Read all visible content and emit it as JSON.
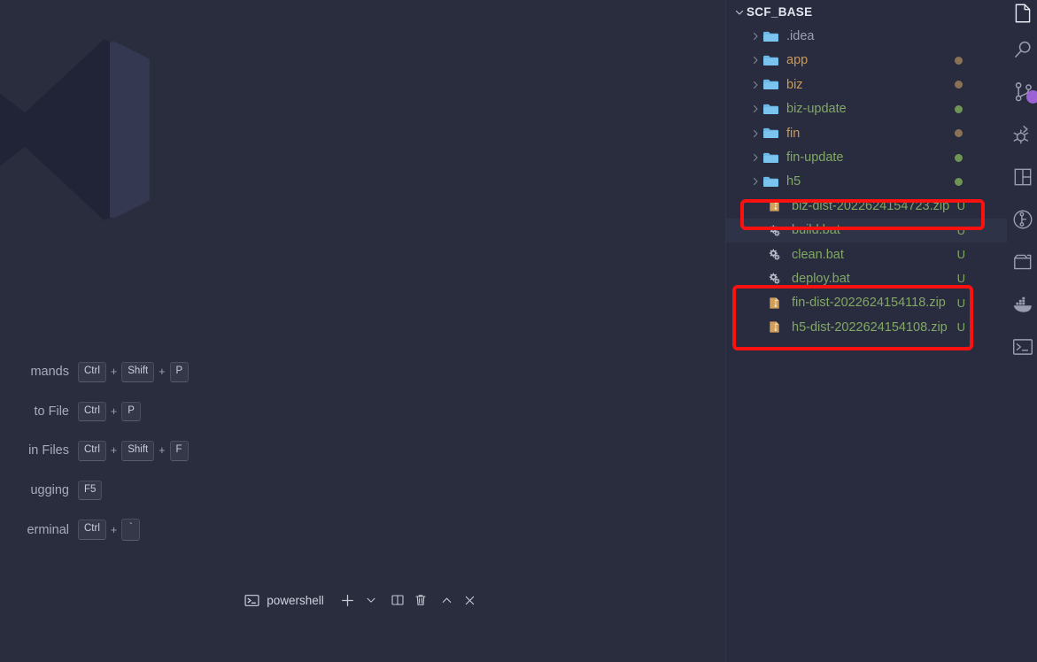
{
  "window": {
    "app": "Visual Studio Code",
    "editor_background": "#2a2d3e",
    "sidebar_background": "#292c3e",
    "annotation_color": "#fc1111",
    "untracked_color": "#81a865",
    "modified_color": "#8a7256"
  },
  "watermark": {
    "icon": "vscode-logo-watermark"
  },
  "shortcuts": {
    "rows": [
      {
        "label": "mands",
        "full_label": "Show All Commands",
        "keys": [
          "Ctrl",
          "Shift",
          "P"
        ]
      },
      {
        "label": "to File",
        "full_label": "Go to File",
        "keys": [
          "Ctrl",
          "P"
        ]
      },
      {
        "label": "in Files",
        "full_label": "Find in Files",
        "keys": [
          "Ctrl",
          "Shift",
          "F"
        ]
      },
      {
        "label": "ugging",
        "full_label": "Start Debugging",
        "keys": [
          "F5"
        ]
      },
      {
        "label": "erminal",
        "full_label": "Toggle Terminal",
        "keys": [
          "Ctrl",
          "`"
        ]
      }
    ],
    "separator": "+"
  },
  "terminal": {
    "icon": "terminal-powershell-icon",
    "name": "powershell",
    "actions": [
      {
        "name": "new-terminal-button",
        "icon": "plus-icon"
      },
      {
        "name": "terminal-profile-dropdown",
        "icon": "chevron-down-icon"
      },
      {
        "name": "split-terminal-button",
        "icon": "split-icon"
      },
      {
        "name": "kill-terminal-button",
        "icon": "trash-icon"
      },
      {
        "name": "maximize-panel-button",
        "icon": "chevron-up-icon"
      },
      {
        "name": "close-panel-button",
        "icon": "close-icon"
      }
    ]
  },
  "explorer": {
    "root": {
      "label": "SCF_BASE",
      "expanded": true
    },
    "items": [
      {
        "label": ".idea",
        "type": "folder",
        "expanded": false,
        "color": "#9ba0b5",
        "decoration": "",
        "dot": ""
      },
      {
        "label": "app",
        "type": "folder",
        "expanded": false,
        "color": "#c99a59",
        "decoration": "",
        "dot": "#8a7256"
      },
      {
        "label": "biz",
        "type": "folder",
        "expanded": false,
        "color": "#c99a59",
        "decoration": "",
        "dot": "#8a7256"
      },
      {
        "label": "biz-update",
        "type": "folder",
        "expanded": false,
        "color": "#81a865",
        "decoration": "",
        "dot": "#6f9456"
      },
      {
        "label": "fin",
        "type": "folder",
        "expanded": false,
        "color": "#c99a59",
        "decoration": "",
        "dot": "#8a7256"
      },
      {
        "label": "fin-update",
        "type": "folder",
        "expanded": false,
        "color": "#81a865",
        "decoration": "",
        "dot": "#6f9456"
      },
      {
        "label": "h5",
        "type": "folder",
        "expanded": false,
        "color": "#81a865",
        "decoration": "",
        "dot": "#6f9456"
      },
      {
        "label": "biz-dist-2022624154723.zip",
        "type": "zip",
        "color": "#81a865",
        "decoration": "U",
        "dot": ""
      },
      {
        "label": "build.bat",
        "type": "bat",
        "color": "#81a865",
        "decoration": "U",
        "dot": "",
        "hover": true
      },
      {
        "label": "clean.bat",
        "type": "bat",
        "color": "#81a865",
        "decoration": "U",
        "dot": ""
      },
      {
        "label": "deploy.bat",
        "type": "bat",
        "color": "#81a865",
        "decoration": "U",
        "dot": ""
      },
      {
        "label": "fin-dist-2022624154118.zip",
        "type": "zip",
        "color": "#81a865",
        "decoration": "U",
        "dot": ""
      },
      {
        "label": "h5-dist-2022624154108.zip",
        "type": "zip",
        "color": "#81a865",
        "decoration": "U",
        "dot": ""
      }
    ]
  },
  "activitybar": {
    "items": [
      {
        "name": "explorer-icon",
        "active": true
      },
      {
        "name": "search-icon",
        "active": false
      },
      {
        "name": "source-control-icon",
        "active": false,
        "badge": true
      },
      {
        "name": "run-and-debug-icon",
        "active": false
      },
      {
        "name": "extensions-icon",
        "active": false
      },
      {
        "name": "testing-icon",
        "active": false
      },
      {
        "name": "remote-explorer-icon",
        "active": false
      },
      {
        "name": "docker-icon",
        "active": false
      },
      {
        "name": "terminal-icon",
        "active": false
      }
    ]
  }
}
